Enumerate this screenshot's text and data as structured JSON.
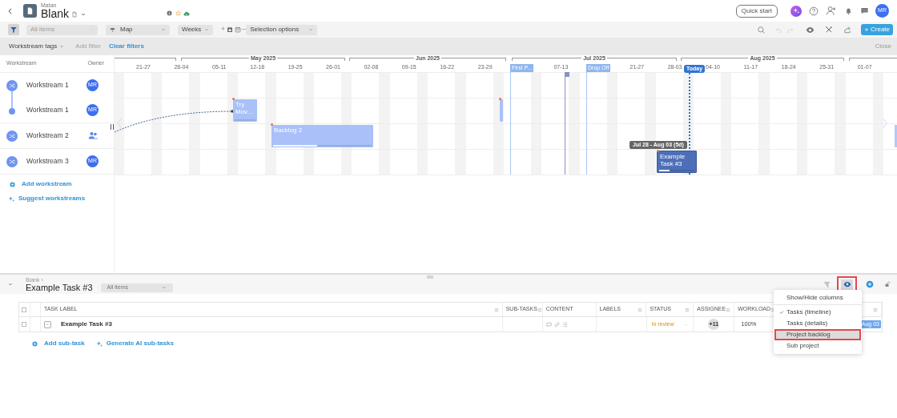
{
  "app_header": {
    "workspace": "Matan",
    "title": "Blank",
    "quick_start": "Quick start",
    "avatar": "MR"
  },
  "toolbar": {
    "filter_selected": true,
    "dropdowns": [
      {
        "kind": "plain",
        "label": "All items",
        "disabled": true
      },
      {
        "kind": "map",
        "label": "Map",
        "disabled": false
      },
      {
        "kind": "plain",
        "label": "Weeks",
        "disabled": false
      },
      {
        "kind": "plain",
        "label": "Selection options",
        "disabled": false
      }
    ],
    "zoom_in": "+",
    "zoom_out": "–",
    "create": "Create"
  },
  "filter_bar": {
    "tag_filter": "Workstream tags",
    "add_filter": {
      "label": "Add filter",
      "disabled": true
    },
    "clear": "Clear filters",
    "close": "Close"
  },
  "timeline": {
    "headers": {
      "workstream": "Workstream",
      "owner": "Owner"
    },
    "months": [
      "May 2025",
      "Jun 2025",
      "Jul 2025",
      "Aug 2025"
    ],
    "weeks": [
      "21-27",
      "28-04",
      "05-11",
      "12-18",
      "19-25",
      "26-01",
      "02-08",
      "09-15",
      "16-22",
      "23-29",
      "07-13",
      "21-27",
      "28-03",
      "04-10",
      "11-17",
      "18-24",
      "25-31",
      "01-07"
    ],
    "today": "Today",
    "milestones": [
      {
        "kind": "flag",
        "label": "First P..."
      },
      {
        "kind": "marker"
      },
      {
        "kind": "flag",
        "label": "Drop Off"
      }
    ],
    "workstreams": [
      {
        "kind": "stream",
        "name": "Workstream 1",
        "owner": {
          "kind": "avatar",
          "initials": "MR"
        }
      },
      {
        "kind": "sub",
        "name": "Workstream 1",
        "owner": {
          "kind": "avatar",
          "initials": "MR"
        },
        "tasks": [
          {
            "label": "Try Mov...",
            "selected": false
          },
          {
            "selected": false
          }
        ]
      },
      {
        "kind": "stream",
        "name": "Workstream 2",
        "owner": {
          "kind": "group"
        },
        "tasks": [
          {
            "label": "Backlog 2",
            "selected": false,
            "level": 0.45
          }
        ]
      },
      {
        "kind": "stream",
        "name": "Workstream 3",
        "owner": {
          "kind": "avatar",
          "initials": "MR"
        },
        "tasks": [
          {
            "label": "Example Task #3",
            "selected": true,
            "level": 0.3,
            "range": "Jul 28 - Aug 03 (5d)"
          }
        ]
      }
    ],
    "add_workstream": "Add workstream",
    "suggest_workstreams": "Suggest workstreams"
  },
  "task_panel": {
    "breadcrumb": "Blank ›",
    "title": "Example Task #3",
    "view": "All items",
    "eye_highlighted": true,
    "all_checked": false,
    "columns": [
      "TASK LABEL",
      "SUB-TASKS",
      "CONTENT",
      "LABELS",
      "STATUS",
      "ASSIGNEE",
      "WORKLOAD"
    ],
    "rows": [
      {
        "checked": false,
        "label": "Example Task #3",
        "status": "In review",
        "assignee": "+11",
        "workload": "100%",
        "date": "Aug 03"
      }
    ],
    "add_subtask": "Add sub-task",
    "generate_subtasks": "Generate AI sub-tasks",
    "column_menu": {
      "title": "Show/Hide columns",
      "items": [
        {
          "label": "Tasks (timeline)",
          "checked": true,
          "highlighted": false
        },
        {
          "label": "Tasks (details)",
          "checked": false,
          "highlighted": false
        },
        {
          "label": "Project backlog",
          "checked": false,
          "highlighted": true
        },
        {
          "label": "Sub project",
          "checked": false,
          "highlighted": false
        }
      ]
    }
  }
}
